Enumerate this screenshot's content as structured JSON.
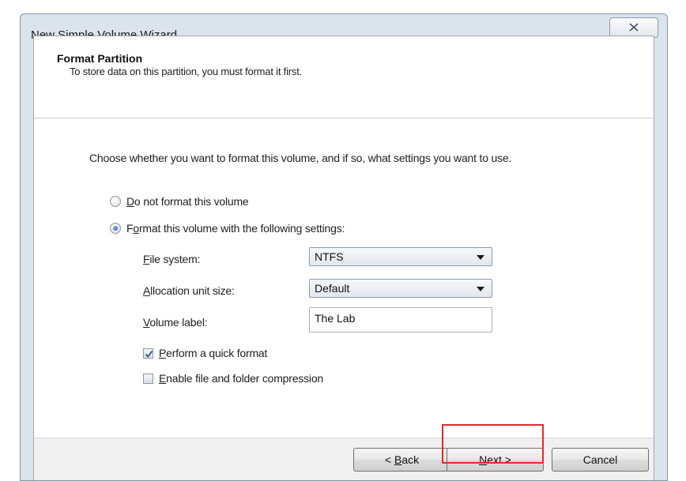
{
  "window": {
    "title": "New Simple Volume Wizard"
  },
  "header": {
    "title": "Format Partition",
    "subtitle": "To store data on this partition, you must format it first."
  },
  "body": {
    "instruction": "Choose whether you want to format this volume, and if so, what settings you want to use."
  },
  "options": {
    "no_format": {
      "mn": "D",
      "rest": "o not format this volume",
      "selected": false
    },
    "format": {
      "pre": "F",
      "mn": "o",
      "rest": "rmat this volume with the following settings:",
      "selected": true
    }
  },
  "settings": {
    "file_system": {
      "mn": "F",
      "rest": "ile system:",
      "value": "NTFS"
    },
    "allocation": {
      "mn": "A",
      "rest": "llocation unit size:",
      "value": "Default"
    },
    "volume_label": {
      "mn": "V",
      "rest": "olume label:",
      "value": "The Lab"
    },
    "quick_format": {
      "mn": "P",
      "rest": "erform a quick format",
      "checked": true
    },
    "compression": {
      "mn": "E",
      "rest": "nable file and folder compression",
      "checked": false
    }
  },
  "buttons": {
    "back": {
      "pre": "< ",
      "mn": "B",
      "rest": "ack"
    },
    "next": {
      "mn": "N",
      "rest": "ext >"
    },
    "cancel": {
      "label": "Cancel"
    }
  },
  "colors": {
    "highlight": "#e32b2b",
    "dialog_frame": "#dbe3ed",
    "radio_dot": "#1d57b5"
  },
  "icons": {
    "close": "close-icon",
    "dropdown": "chevron-down-icon",
    "check": "checkmark-icon"
  }
}
